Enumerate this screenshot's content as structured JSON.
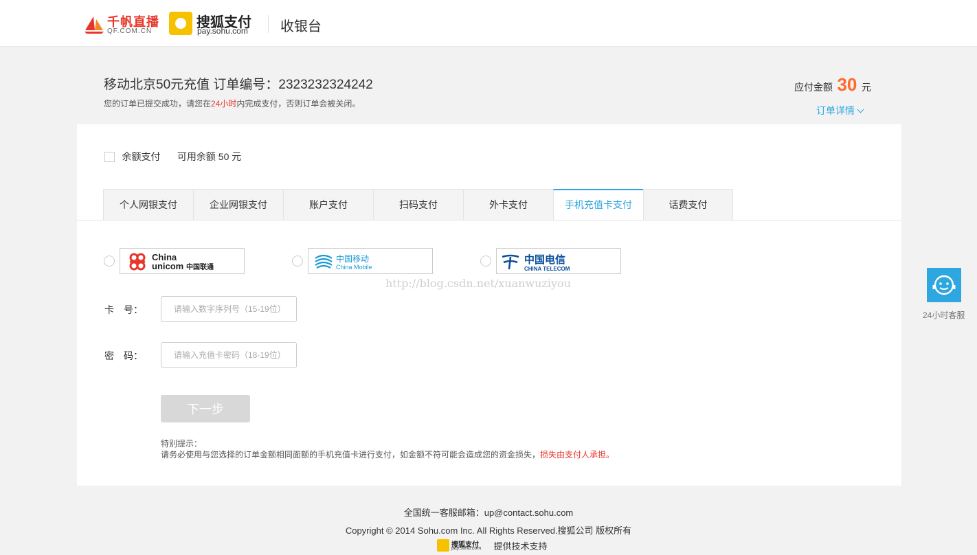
{
  "header": {
    "qf_logo_cn": "千帆直播",
    "qf_logo_en": "QF.COM.CN",
    "sohu_logo_cn": "搜狐支付",
    "sohu_logo_en": "pay.sohu.com",
    "title": "收银台"
  },
  "order": {
    "title": "移动北京50元充值 订单编号：2323232324242",
    "notice_pre": "您的订单已提交成功，请您在",
    "notice_highlight": "24小时",
    "notice_post": "内完成支付，否则订单会被关闭。",
    "amount_label": "应付金额",
    "amount_value": "30",
    "amount_unit": "元",
    "detail_link": "订单详情"
  },
  "balance": {
    "label": "余额支付",
    "available": "可用余额 50 元"
  },
  "tabs": [
    {
      "label": "个人网银支付"
    },
    {
      "label": "企业网银支付"
    },
    {
      "label": "账户支付"
    },
    {
      "label": "扫码支付"
    },
    {
      "label": "外卡支付"
    },
    {
      "label": "手机充值卡支付",
      "active": true
    },
    {
      "label": "话费支付"
    }
  ],
  "carriers": {
    "unicom": {
      "line1": "China",
      "line2": "unicom",
      "cn": "中国联通"
    },
    "mobile": {
      "cn": "中国移动",
      "en": "China Mobile"
    },
    "telecom": {
      "cn": "中国电信",
      "en": "CHINA TELECOM"
    }
  },
  "watermark": "http://blog.csdn.net/xuanwuziyou",
  "form": {
    "card_label": "卡　号：",
    "card_placeholder": "请输入数字序列号（15-19位）",
    "pwd_label": "密　码：",
    "pwd_placeholder": "请输入充值卡密码（18-19位）",
    "next_button": "下一步"
  },
  "tips": {
    "title": "特别提示：",
    "text": "请务必使用与您选择的订单金额相同面额的手机充值卡进行支付，如金额不符可能会造成您的资金损失，",
    "highlight": "损失由支付人承担。"
  },
  "customer_service": {
    "label": "24小时客服"
  },
  "footer": {
    "email_line": "全国统一客服邮箱：up@contact.sohu.com",
    "copyright": "Copyright © 2014 Sohu.com Inc. All Rights Reserved.搜狐公司 版权所有",
    "badge_cn": "搜狐支付",
    "badge_en": "pay.sohu.com",
    "support": "提供技术支持"
  },
  "colors": {
    "accent": "#2ea7e0",
    "amount": "#ff6a2b",
    "warning": "#e8352a"
  }
}
